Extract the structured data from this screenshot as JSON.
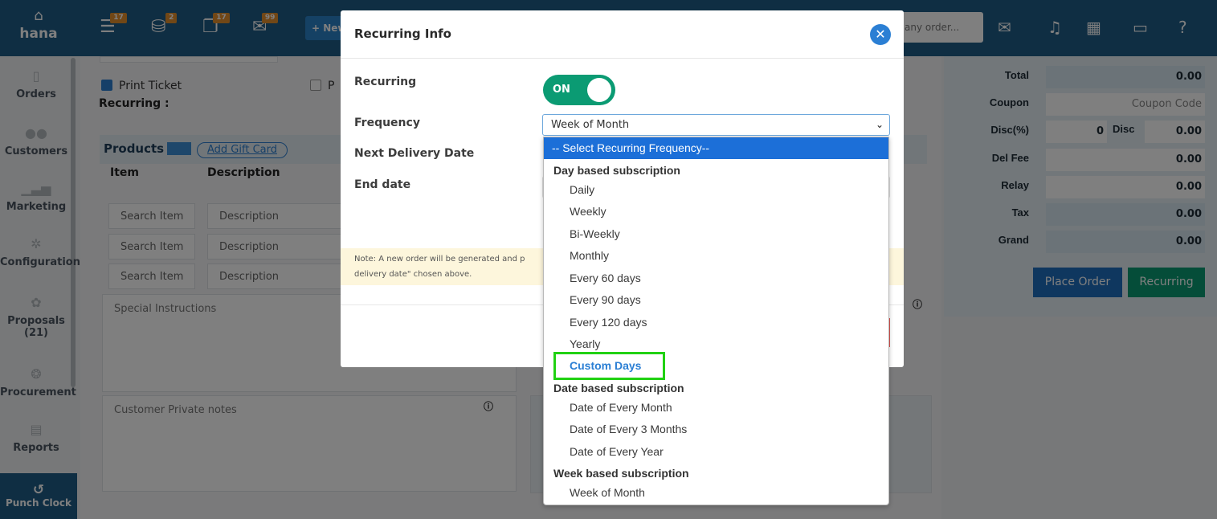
{
  "app": {
    "brand": "hana"
  },
  "sidebar": {
    "items": [
      {
        "label": "Orders",
        "icon": "document-icon"
      },
      {
        "label": "Customers",
        "icon": "users-icon"
      },
      {
        "label": "Marketing",
        "icon": "chart-icon"
      },
      {
        "label": "Configuration",
        "icon": "gear-icon"
      },
      {
        "label": "Proposals",
        "count": "(21)",
        "icon": "proposal-icon"
      },
      {
        "label": "Procurement",
        "icon": "procurement-icon"
      },
      {
        "label": "Reports",
        "icon": "report-icon"
      }
    ],
    "punch_clock": "Punch Clock"
  },
  "topbar": {
    "badges": [
      "17",
      "2",
      "17",
      "99"
    ],
    "new_label": "+ New",
    "order_search_placeholder": "any order..."
  },
  "form": {
    "print_ticket": "Print Ticket",
    "print_second": "P",
    "recurring_label": "Recurring :",
    "products": "Products",
    "add_gift_card": "Add Gift Card",
    "col_item": "Item",
    "col_description": "Description",
    "search_item": "Search Item",
    "description": "Description",
    "special_instructions": "Special Instructions",
    "customer_private_notes": "Customer Private notes"
  },
  "totals": {
    "rows": [
      {
        "label": "Total",
        "value": "0.00"
      },
      {
        "label": "Coupon",
        "value": "Coupon Code"
      },
      {
        "label": "Disc(%)",
        "value": "0",
        "label2": "Disc",
        "value2": "0.00"
      },
      {
        "label": "Del Fee",
        "value": "0.00"
      },
      {
        "label": "Relay",
        "value": "0.00"
      },
      {
        "label": "Tax",
        "value": "0.00"
      },
      {
        "label": "Grand",
        "value": "0.00"
      }
    ],
    "place_order": "Place Order",
    "recurring": "Recurring"
  },
  "modal": {
    "title": "Recurring Info",
    "recurring_label": "Recurring",
    "toggle_text": "ON",
    "frequency_label": "Frequency",
    "frequency_value": "Week of Month",
    "next_delivery_label": "Next Delivery Date",
    "end_date_label": "End date",
    "note_line1": "Note: A new order will be generated and p",
    "note_line2": "delivery date\" chosen above."
  },
  "dropdown": {
    "placeholder": "-- Select Recurring Frequency--",
    "groups": [
      {
        "label": "Day based subscription",
        "options": [
          "Daily",
          "Weekly",
          "Bi-Weekly",
          "Monthly",
          "Every 60 days",
          "Every 90 days",
          "Every 120 days",
          "Yearly",
          "Custom Days"
        ]
      },
      {
        "label": "Date based subscription",
        "options": [
          "Date of Every Month",
          "Date of Every 3 Months",
          "Date of Every Year"
        ]
      },
      {
        "label": "Week based subscription",
        "options": [
          "Week of Month"
        ]
      }
    ],
    "highlighted": "Custom Days"
  },
  "colors": {
    "brand": "#1f5c86",
    "accent": "#2b7fd4",
    "toggle_on": "#0b9b73",
    "highlight": "#21d113"
  }
}
